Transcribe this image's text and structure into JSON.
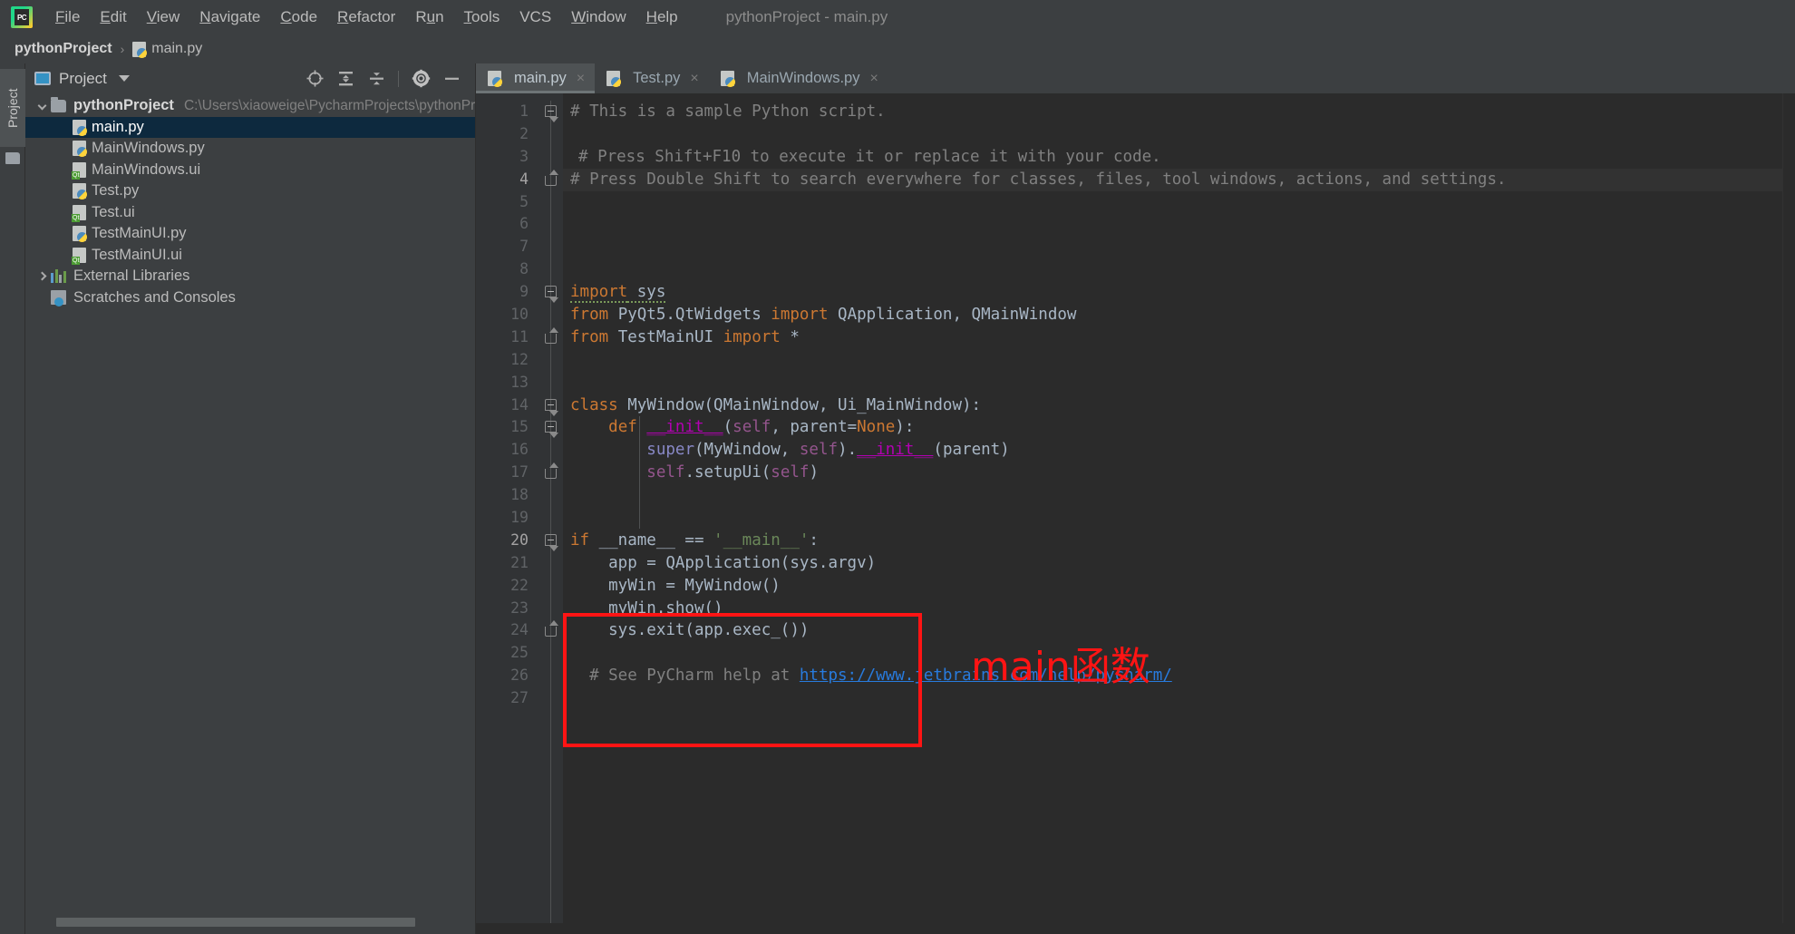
{
  "window": {
    "title": "pythonProject - main.py",
    "app_icon": "pycharm-logo-icon"
  },
  "menubar": {
    "items": [
      {
        "label": "File",
        "mnemonic": "F"
      },
      {
        "label": "Edit",
        "mnemonic": "E"
      },
      {
        "label": "View",
        "mnemonic": "V"
      },
      {
        "label": "Navigate",
        "mnemonic": "N"
      },
      {
        "label": "Code",
        "mnemonic": "C"
      },
      {
        "label": "Refactor",
        "mnemonic": "R"
      },
      {
        "label": "Run",
        "mnemonic": "u"
      },
      {
        "label": "Tools",
        "mnemonic": "T"
      },
      {
        "label": "VCS",
        "mnemonic": ""
      },
      {
        "label": "Window",
        "mnemonic": "W"
      },
      {
        "label": "Help",
        "mnemonic": "H"
      }
    ]
  },
  "breadcrumb": {
    "project": "pythonProject",
    "separator": "›",
    "file": "main.py"
  },
  "tool_rail": {
    "project_tab": "Project"
  },
  "project_panel": {
    "header_label": "Project",
    "toolbar_icons": [
      "locate-target-icon",
      "expand-all-icon",
      "collapse-all-icon",
      "settings-gear-icon",
      "hide-minimize-icon"
    ],
    "tree": [
      {
        "label": "pythonProject",
        "path": "C:\\Users\\xiaoweige\\PycharmProjects\\pythonProject",
        "icon": "folder-icon",
        "indent": 0,
        "arrow": "down",
        "bold": true,
        "selected": false
      },
      {
        "label": "main.py",
        "path": "",
        "icon": "python-file-icon",
        "indent": 1,
        "arrow": "none",
        "bold": false,
        "selected": true
      },
      {
        "label": "MainWindows.py",
        "path": "",
        "icon": "python-file-icon",
        "indent": 1,
        "arrow": "none",
        "bold": false,
        "selected": false
      },
      {
        "label": "MainWindows.ui",
        "path": "",
        "icon": "qt-ui-file-icon",
        "indent": 1,
        "arrow": "none",
        "bold": false,
        "selected": false
      },
      {
        "label": "Test.py",
        "path": "",
        "icon": "python-file-icon",
        "indent": 1,
        "arrow": "none",
        "bold": false,
        "selected": false
      },
      {
        "label": "Test.ui",
        "path": "",
        "icon": "qt-ui-file-icon",
        "indent": 1,
        "arrow": "none",
        "bold": false,
        "selected": false
      },
      {
        "label": "TestMainUI.py",
        "path": "",
        "icon": "python-file-icon",
        "indent": 1,
        "arrow": "none",
        "bold": false,
        "selected": false
      },
      {
        "label": "TestMainUI.ui",
        "path": "",
        "icon": "qt-ui-file-icon",
        "indent": 1,
        "arrow": "none",
        "bold": false,
        "selected": false
      },
      {
        "label": "External Libraries",
        "path": "",
        "icon": "external-libraries-icon",
        "indent": 0,
        "arrow": "right",
        "bold": false,
        "selected": false
      },
      {
        "label": "Scratches and Consoles",
        "path": "",
        "icon": "scratches-icon",
        "indent": 0,
        "arrow": "none",
        "bold": false,
        "selected": false
      }
    ]
  },
  "editor": {
    "tabs": [
      {
        "label": "main.py",
        "icon": "python-file-icon",
        "active": true
      },
      {
        "label": "Test.py",
        "icon": "python-file-icon",
        "active": false
      },
      {
        "label": "MainWindows.py",
        "icon": "python-file-icon",
        "active": false
      }
    ],
    "close_glyph": "×",
    "line_numbers": [
      1,
      2,
      3,
      4,
      5,
      6,
      7,
      8,
      9,
      10,
      11,
      12,
      13,
      14,
      15,
      16,
      17,
      18,
      19,
      20,
      21,
      22,
      23,
      24,
      25,
      26,
      27
    ],
    "current_line": 20,
    "run_gutter_line": 20,
    "code_lines": [
      "# This is a sample Python script.",
      "",
      "# Press Shift+F10 to execute it or replace it with your code.",
      "# Press Double Shift to search everywhere for classes, files, tool windows, actions, and settings.",
      "",
      "",
      "",
      "",
      "import sys",
      "from PyQt5.QtWidgets import QApplication, QMainWindow",
      "from TestMainUI import *",
      "",
      "",
      "class MyWindow(QMainWindow, Ui_MainWindow):",
      "    def __init__(self, parent=None):",
      "        super(MyWindow, self).__init__(parent)",
      "        self.setupUi(self)",
      "",
      "",
      "if __name__ == '__main__':",
      "    app = QApplication(sys.argv)",
      "    myWin = MyWindow()",
      "    myWin.show()",
      "    sys.exit(app.exec_())",
      "",
      "# See PyCharm help at https://www.jetbrains.com/help/pycharm/",
      ""
    ],
    "help_url": "https://www.jetbrains.com/help/pycharm/"
  },
  "annotation": {
    "label": "main函数",
    "color": "#ff1414",
    "box_covers_lines": "20-24"
  },
  "colors": {
    "ide_chrome": "#3c3f41",
    "editor_bg": "#2b2b2b",
    "gutter_bg": "#313335",
    "selection_blue": "#0d293e",
    "keyword_orange": "#cc7832",
    "string_green": "#6a8759",
    "comment_gray": "#808080",
    "self_purple": "#94558d",
    "dunder_magenta": "#b200b2",
    "builtin_blue": "#8888c6",
    "link_blue": "#287bde",
    "run_green": "#499c54",
    "annotation_red": "#ff1414"
  }
}
